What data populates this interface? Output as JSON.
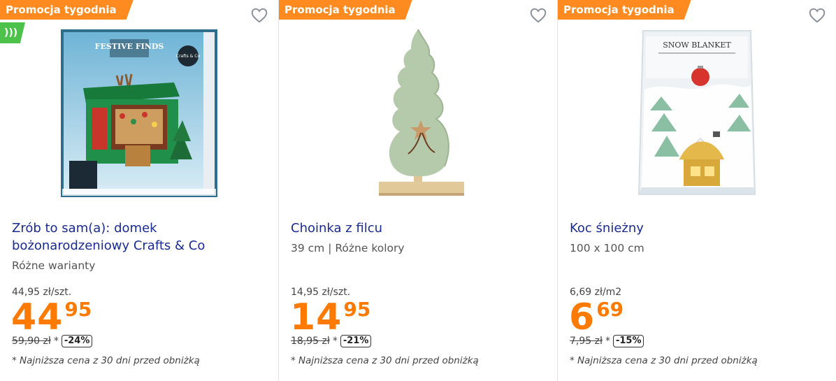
{
  "promo_label": "Promocja tygodnia",
  "accent_color": "#ff8a1f",
  "price_color": "#ff7a00",
  "title_color": "#1a2b8f",
  "products": [
    {
      "title": "Zrób to sam(a): domek bożonarodzeniowy Crafts & Co",
      "subtitle": "Różne warianty",
      "unit_price": "44,95 zł/szt.",
      "price_int": "44",
      "price_dec": "95",
      "old_price": "59,90 zł",
      "old_mark": "*",
      "discount": "-24%",
      "note": "* Najniższa cena z 30 dni przed obniżką",
      "image_text_brand": "FESTIVE FINDS",
      "image_text_logo": "Crafts & Co",
      "badge_icon": "online-icon"
    },
    {
      "title": "Choinka z filcu",
      "subtitle": "39 cm | Różne kolory",
      "unit_price": "14,95 zł/szt.",
      "price_int": "14",
      "price_dec": "95",
      "old_price": "18,95 zł",
      "old_mark": "*",
      "discount": "-21%",
      "note": "* Najniższa cena z 30 dni przed obniżką"
    },
    {
      "title": "Koc śnieżny",
      "subtitle": "100 x 100 cm",
      "unit_price": "6,69 zł/m2",
      "price_int": "6",
      "price_dec": "69",
      "old_price": "7,95 zł",
      "old_mark": "*",
      "discount": "-15%",
      "note": "* Najniższa cena z 30 dni przed obniżką",
      "image_text_brand": "SNOW BLANKET"
    }
  ]
}
